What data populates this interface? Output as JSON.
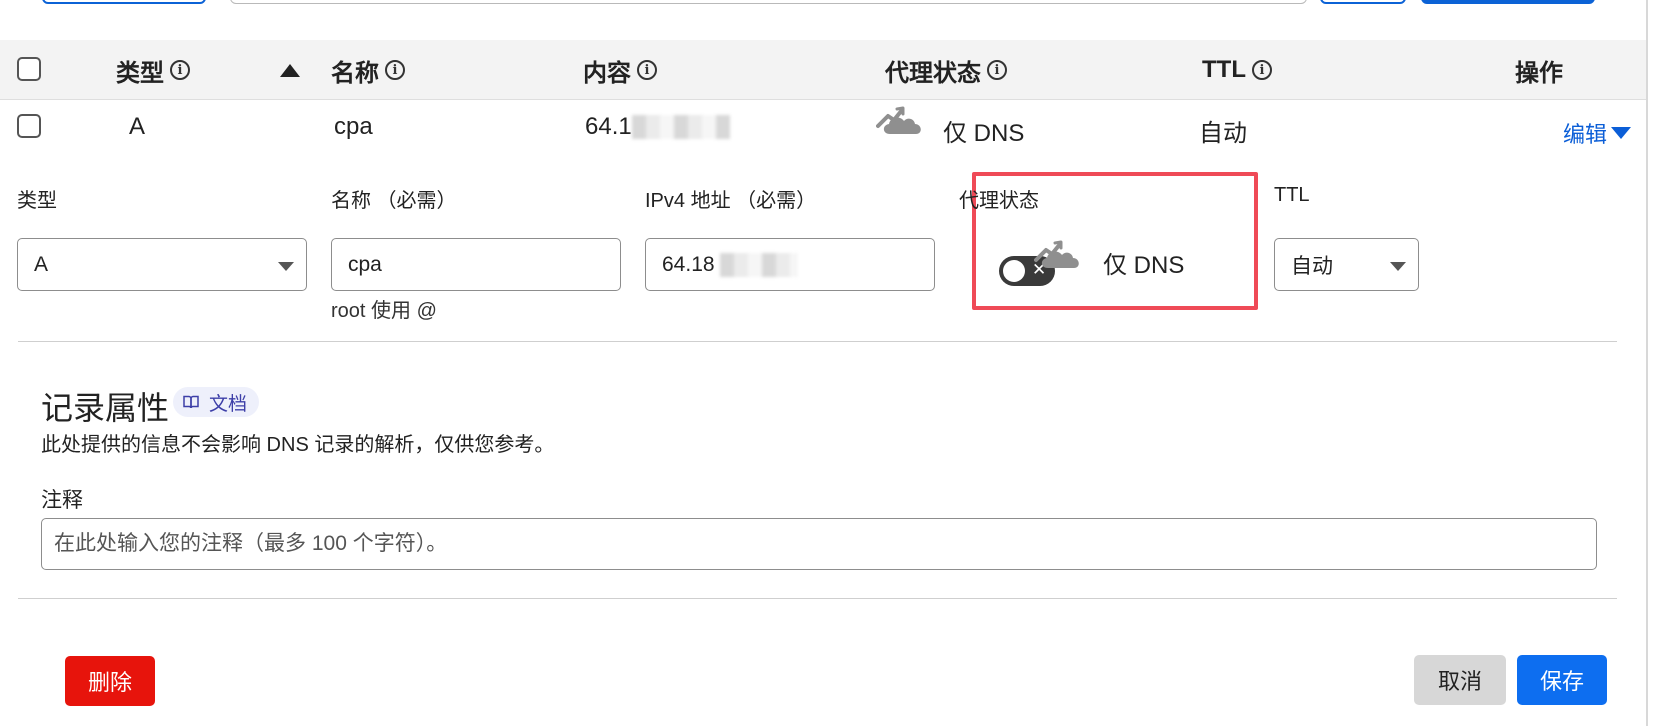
{
  "table": {
    "headers": {
      "type": "类型",
      "name": "名称",
      "content": "内容",
      "proxy_status": "代理状态",
      "ttl": "TTL",
      "actions": "操作"
    },
    "row": {
      "type": "A",
      "name": "cpa",
      "content_prefix": "64.1",
      "proxy_status": "仅 DNS",
      "ttl": "自动",
      "edit_label": "编辑"
    }
  },
  "form": {
    "type_label": "类型",
    "type_value": "A",
    "name_label": "名称 （必需）",
    "name_value": "cpa",
    "name_hint": "root 使用 @",
    "ipv4_label": "IPv4 地址 （必需）",
    "ipv4_value": "64.18",
    "proxy_label": "代理状态",
    "proxy_status": "仅 DNS",
    "proxy_enabled": false,
    "ttl_label": "TTL",
    "ttl_value": "自动"
  },
  "record_props": {
    "title": "记录属性",
    "doc_badge": "文档",
    "description": "此处提供的信息不会影响 DNS 记录的解析，仅供您参考。",
    "note_label": "注释",
    "note_placeholder": "在此处输入您的注释（最多 100 个字符）。"
  },
  "buttons": {
    "delete": "删除",
    "cancel": "取消",
    "save": "保存"
  },
  "colors": {
    "primary": "#0d6ef0",
    "danger": "#e7140c",
    "highlight": "#ef4a57",
    "link": "#0b5ed7"
  },
  "icons": {
    "info": "info-icon",
    "sort": "sort-ascending-icon",
    "cloud": "dns-only-cloud-icon",
    "caret": "chevron-down-icon",
    "book": "book-icon"
  }
}
